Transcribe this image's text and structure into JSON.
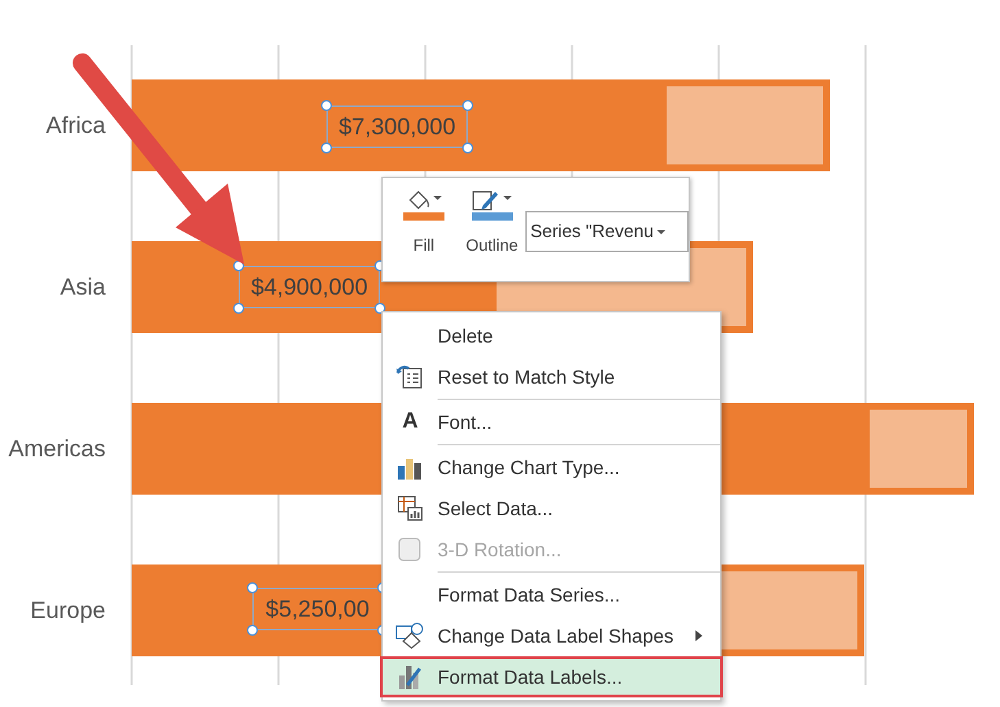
{
  "chart": {
    "categories": [
      {
        "name": "Africa",
        "label": "$7,300,000"
      },
      {
        "name": "Asia",
        "label": "$4,900,000"
      },
      {
        "name": "Americas"
      },
      {
        "name": "Europe",
        "label": "$5,250,00"
      }
    ]
  },
  "mini_toolbar": {
    "fill": {
      "label": "Fill",
      "color": "#ed7d31"
    },
    "outline": {
      "label": "Outline",
      "color": "#5b9bd5"
    },
    "series_select": {
      "value": "Series \"Revenu"
    }
  },
  "context_menu": {
    "items": [
      {
        "kind": "plain",
        "label": "Delete",
        "disabled": false,
        "selected": false,
        "submenu": false
      },
      {
        "kind": "reset",
        "label": "Reset to Match Style",
        "disabled": false,
        "selected": false,
        "submenu": false
      },
      {
        "kind": "separator"
      },
      {
        "kind": "font",
        "icon_text": "A",
        "label": "Font...",
        "disabled": false,
        "selected": false,
        "submenu": false
      },
      {
        "kind": "separator"
      },
      {
        "kind": "chart",
        "label": "Change Chart Type...",
        "disabled": false,
        "selected": false,
        "submenu": false
      },
      {
        "kind": "table",
        "label": "Select Data...",
        "disabled": false,
        "selected": false,
        "submenu": false
      },
      {
        "kind": "cube",
        "label": "3-D Rotation...",
        "disabled": true,
        "selected": false,
        "submenu": false
      },
      {
        "kind": "separator"
      },
      {
        "kind": "plain",
        "label": "Format Data Series...",
        "disabled": false,
        "selected": false,
        "submenu": false
      },
      {
        "kind": "shapes",
        "label": "Change Data Label Shapes",
        "disabled": false,
        "selected": false,
        "submenu": true
      },
      {
        "kind": "format",
        "label": "Format Data Labels...",
        "disabled": false,
        "selected": true,
        "submenu": false
      }
    ]
  }
}
